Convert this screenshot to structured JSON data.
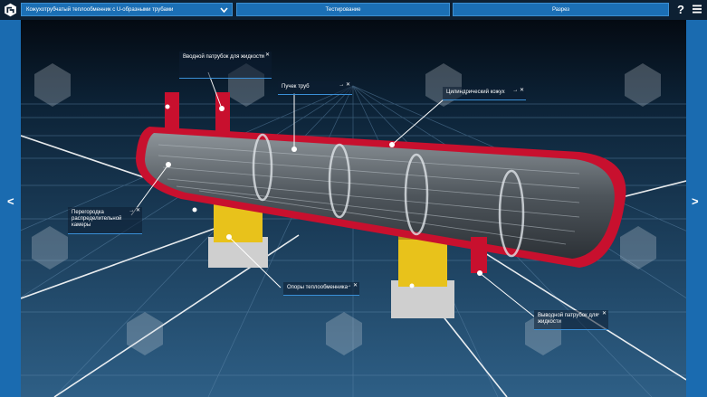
{
  "header": {
    "model_select": "Кожухотрубчатый теплообменник с U-образными трубами",
    "tabs": [
      "Тестирование",
      "Разрез"
    ],
    "help": "?"
  },
  "nav": {
    "prev": "<",
    "next": ">"
  },
  "labels": [
    "Вводной патрубок для жидкости",
    "Пучек труб",
    "Цилиндрический кожух",
    "Перегородка распределительной камеры",
    "Опоры теплообменника",
    "Выводной патрубок для жидкости"
  ],
  "label_controls": "→ ✕",
  "colors": {
    "accent": "#1b6fb5",
    "shell_red": "#c8102e",
    "support_yellow": "#e8c21b",
    "grid_blue": "#2a5f8c"
  }
}
